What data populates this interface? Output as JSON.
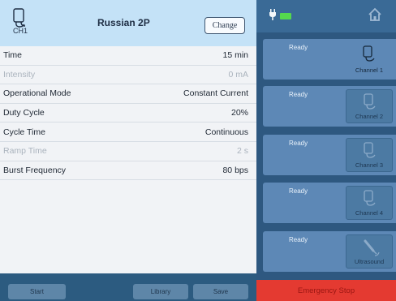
{
  "header": {
    "channel_label": "CH1",
    "program_name": "Russian 2P",
    "change_label": "Change"
  },
  "params": [
    {
      "label": "Time",
      "value": "15 min",
      "enabled": true
    },
    {
      "label": "Intensity",
      "value": "0 mA",
      "enabled": false
    },
    {
      "label": "Operational Mode",
      "value": "Constant Current",
      "enabled": true
    },
    {
      "label": "Duty Cycle",
      "value": "20%",
      "enabled": true
    },
    {
      "label": "Cycle Time",
      "value": "Continuous",
      "enabled": true
    },
    {
      "label": "Ramp Time",
      "value": "2 s",
      "enabled": false
    },
    {
      "label": "Burst Frequency",
      "value": "80 bps",
      "enabled": true
    }
  ],
  "footer": {
    "start_label": "Start",
    "library_label": "Library",
    "save_label": "Save"
  },
  "status_bar": {
    "plug_icon": "plug-icon",
    "battery_icon": "battery-icon",
    "home_icon": "home-icon",
    "battery_color": "#55d84d"
  },
  "channels": [
    {
      "status": "Ready",
      "button_label": "Channel 1",
      "icon": "channel-electrode-icon",
      "active": true
    },
    {
      "status": "Ready",
      "button_label": "Channel 2",
      "icon": "channel-electrode-icon",
      "active": false
    },
    {
      "status": "Ready",
      "button_label": "Channel 3",
      "icon": "channel-electrode-icon",
      "active": false
    },
    {
      "status": "Ready",
      "button_label": "Channel 4",
      "icon": "channel-electrode-icon",
      "active": false
    },
    {
      "status": "Ready",
      "button_label": "Ultrasound",
      "icon": "ultrasound-probe-icon",
      "active": false
    }
  ],
  "emergency": {
    "label": "Emergency Stop",
    "color": "#e43a31"
  },
  "colors": {
    "header_bg": "#c4e2f7",
    "panel_bg": "#2e5880",
    "card_bg": "#5d88b6"
  }
}
